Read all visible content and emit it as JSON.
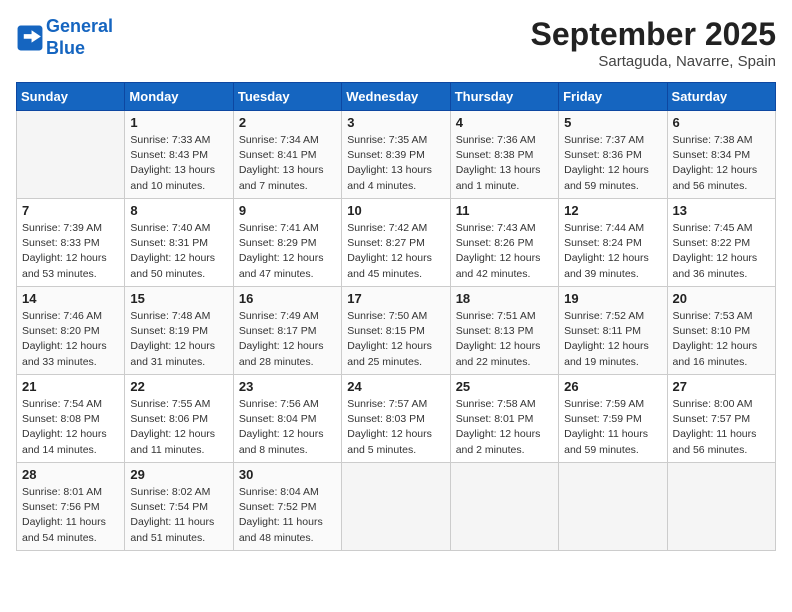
{
  "header": {
    "logo_line1": "General",
    "logo_line2": "Blue",
    "month": "September 2025",
    "location": "Sartaguda, Navarre, Spain"
  },
  "days_of_week": [
    "Sunday",
    "Monday",
    "Tuesday",
    "Wednesday",
    "Thursday",
    "Friday",
    "Saturday"
  ],
  "weeks": [
    [
      {
        "day": "",
        "info": ""
      },
      {
        "day": "1",
        "info": "Sunrise: 7:33 AM\nSunset: 8:43 PM\nDaylight: 13 hours\nand 10 minutes."
      },
      {
        "day": "2",
        "info": "Sunrise: 7:34 AM\nSunset: 8:41 PM\nDaylight: 13 hours\nand 7 minutes."
      },
      {
        "day": "3",
        "info": "Sunrise: 7:35 AM\nSunset: 8:39 PM\nDaylight: 13 hours\nand 4 minutes."
      },
      {
        "day": "4",
        "info": "Sunrise: 7:36 AM\nSunset: 8:38 PM\nDaylight: 13 hours\nand 1 minute."
      },
      {
        "day": "5",
        "info": "Sunrise: 7:37 AM\nSunset: 8:36 PM\nDaylight: 12 hours\nand 59 minutes."
      },
      {
        "day": "6",
        "info": "Sunrise: 7:38 AM\nSunset: 8:34 PM\nDaylight: 12 hours\nand 56 minutes."
      }
    ],
    [
      {
        "day": "7",
        "info": "Sunrise: 7:39 AM\nSunset: 8:33 PM\nDaylight: 12 hours\nand 53 minutes."
      },
      {
        "day": "8",
        "info": "Sunrise: 7:40 AM\nSunset: 8:31 PM\nDaylight: 12 hours\nand 50 minutes."
      },
      {
        "day": "9",
        "info": "Sunrise: 7:41 AM\nSunset: 8:29 PM\nDaylight: 12 hours\nand 47 minutes."
      },
      {
        "day": "10",
        "info": "Sunrise: 7:42 AM\nSunset: 8:27 PM\nDaylight: 12 hours\nand 45 minutes."
      },
      {
        "day": "11",
        "info": "Sunrise: 7:43 AM\nSunset: 8:26 PM\nDaylight: 12 hours\nand 42 minutes."
      },
      {
        "day": "12",
        "info": "Sunrise: 7:44 AM\nSunset: 8:24 PM\nDaylight: 12 hours\nand 39 minutes."
      },
      {
        "day": "13",
        "info": "Sunrise: 7:45 AM\nSunset: 8:22 PM\nDaylight: 12 hours\nand 36 minutes."
      }
    ],
    [
      {
        "day": "14",
        "info": "Sunrise: 7:46 AM\nSunset: 8:20 PM\nDaylight: 12 hours\nand 33 minutes."
      },
      {
        "day": "15",
        "info": "Sunrise: 7:48 AM\nSunset: 8:19 PM\nDaylight: 12 hours\nand 31 minutes."
      },
      {
        "day": "16",
        "info": "Sunrise: 7:49 AM\nSunset: 8:17 PM\nDaylight: 12 hours\nand 28 minutes."
      },
      {
        "day": "17",
        "info": "Sunrise: 7:50 AM\nSunset: 8:15 PM\nDaylight: 12 hours\nand 25 minutes."
      },
      {
        "day": "18",
        "info": "Sunrise: 7:51 AM\nSunset: 8:13 PM\nDaylight: 12 hours\nand 22 minutes."
      },
      {
        "day": "19",
        "info": "Sunrise: 7:52 AM\nSunset: 8:11 PM\nDaylight: 12 hours\nand 19 minutes."
      },
      {
        "day": "20",
        "info": "Sunrise: 7:53 AM\nSunset: 8:10 PM\nDaylight: 12 hours\nand 16 minutes."
      }
    ],
    [
      {
        "day": "21",
        "info": "Sunrise: 7:54 AM\nSunset: 8:08 PM\nDaylight: 12 hours\nand 14 minutes."
      },
      {
        "day": "22",
        "info": "Sunrise: 7:55 AM\nSunset: 8:06 PM\nDaylight: 12 hours\nand 11 minutes."
      },
      {
        "day": "23",
        "info": "Sunrise: 7:56 AM\nSunset: 8:04 PM\nDaylight: 12 hours\nand 8 minutes."
      },
      {
        "day": "24",
        "info": "Sunrise: 7:57 AM\nSunset: 8:03 PM\nDaylight: 12 hours\nand 5 minutes."
      },
      {
        "day": "25",
        "info": "Sunrise: 7:58 AM\nSunset: 8:01 PM\nDaylight: 12 hours\nand 2 minutes."
      },
      {
        "day": "26",
        "info": "Sunrise: 7:59 AM\nSunset: 7:59 PM\nDaylight: 11 hours\nand 59 minutes."
      },
      {
        "day": "27",
        "info": "Sunrise: 8:00 AM\nSunset: 7:57 PM\nDaylight: 11 hours\nand 56 minutes."
      }
    ],
    [
      {
        "day": "28",
        "info": "Sunrise: 8:01 AM\nSunset: 7:56 PM\nDaylight: 11 hours\nand 54 minutes."
      },
      {
        "day": "29",
        "info": "Sunrise: 8:02 AM\nSunset: 7:54 PM\nDaylight: 11 hours\nand 51 minutes."
      },
      {
        "day": "30",
        "info": "Sunrise: 8:04 AM\nSunset: 7:52 PM\nDaylight: 11 hours\nand 48 minutes."
      },
      {
        "day": "",
        "info": ""
      },
      {
        "day": "",
        "info": ""
      },
      {
        "day": "",
        "info": ""
      },
      {
        "day": "",
        "info": ""
      }
    ]
  ]
}
